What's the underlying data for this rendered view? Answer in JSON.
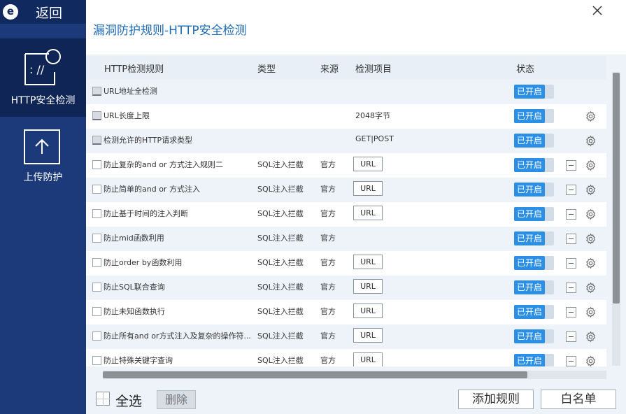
{
  "sidebar": {
    "back_label": "返回",
    "logo_letter": "e",
    "items": [
      {
        "label": "HTTP安全检测",
        "icon": "http-shield-icon"
      },
      {
        "label": "上传防护",
        "icon": "upload-icon"
      }
    ]
  },
  "header": {
    "title": "漏洞防护规则-HTTP安全检测"
  },
  "table": {
    "columns": [
      "HTTP检测规则",
      "类型",
      "来源",
      "检测项目",
      "状态"
    ],
    "rows": [
      {
        "rule": "URL地址全检测",
        "type": "",
        "source": "",
        "item": "",
        "item_button": false,
        "status": "已开启",
        "locked": true,
        "minus": false,
        "gear": false
      },
      {
        "rule": "URL长度上限",
        "type": "",
        "source": "",
        "item": "2048字节",
        "item_button": false,
        "status": "已开启",
        "locked": true,
        "minus": false,
        "gear": true
      },
      {
        "rule": "检测允许的HTTP请求类型",
        "type": "",
        "source": "",
        "item": "GET|POST",
        "item_button": false,
        "status": "已开启",
        "locked": true,
        "minus": false,
        "gear": true
      },
      {
        "rule": "防止复杂的and or 方式注入规则二",
        "type": "SQL注入拦截",
        "source": "官方",
        "item": "URL",
        "item_button": true,
        "status": "已开启",
        "locked": false,
        "minus": true,
        "gear": true
      },
      {
        "rule": "防止简单的and or 方式注入",
        "type": "SQL注入拦截",
        "source": "官方",
        "item": "URL",
        "item_button": true,
        "status": "已开启",
        "locked": false,
        "minus": true,
        "gear": true
      },
      {
        "rule": "防止基于时间的注入判断",
        "type": "SQL注入拦截",
        "source": "官方",
        "item": "URL",
        "item_button": true,
        "status": "已开启",
        "locked": false,
        "minus": true,
        "gear": true
      },
      {
        "rule": "防止mid函数利用",
        "type": "SQL注入拦截",
        "source": "官方",
        "item": "",
        "item_button": false,
        "status": "已开启",
        "locked": false,
        "minus": true,
        "gear": true
      },
      {
        "rule": "防止order by函数利用",
        "type": "SQL注入拦截",
        "source": "官方",
        "item": "URL",
        "item_button": true,
        "status": "已开启",
        "locked": false,
        "minus": true,
        "gear": true
      },
      {
        "rule": "防止SQL联合查询",
        "type": "SQL注入拦截",
        "source": "官方",
        "item": "URL",
        "item_button": true,
        "status": "已开启",
        "locked": false,
        "minus": true,
        "gear": true
      },
      {
        "rule": "防止未知函数执行",
        "type": "SQL注入拦截",
        "source": "官方",
        "item": "URL",
        "item_button": true,
        "status": "已开启",
        "locked": false,
        "minus": true,
        "gear": true
      },
      {
        "rule": "防止所有and or方式注入及复杂的操作符...",
        "type": "SQL注入拦截",
        "source": "官方",
        "item": "URL",
        "item_button": true,
        "status": "已开启",
        "locked": false,
        "minus": true,
        "gear": true
      },
      {
        "rule": "防止特殊关键字查询",
        "type": "SQL注入拦截",
        "source": "官方",
        "item": "URL",
        "item_button": true,
        "status": "已开启",
        "locked": false,
        "minus": true,
        "gear": true
      }
    ]
  },
  "footer": {
    "select_all_label": "全选",
    "delete_label": "删除",
    "add_rule_label": "添加规则",
    "whitelist_label": "白名单"
  },
  "colors": {
    "sidebar_bg": "#1c3a7a",
    "sidebar_active": "#0e2556",
    "title_blue": "#1e6bb8",
    "toggle_on": "#2b8fe6"
  }
}
